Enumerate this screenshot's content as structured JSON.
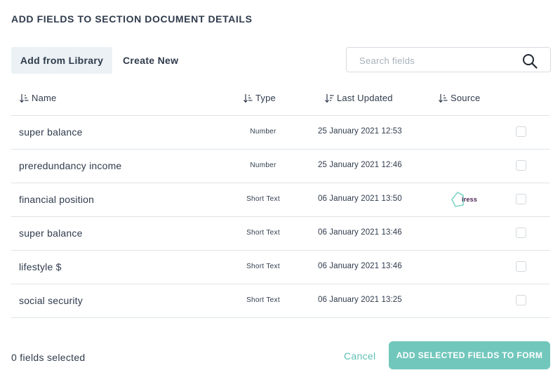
{
  "modal": {
    "title": "ADD FIELDS TO SECTION DOCUMENT DETAILS"
  },
  "tabs": [
    {
      "label": "Add from Library",
      "active": true
    },
    {
      "label": "Create New",
      "active": false
    }
  ],
  "search": {
    "placeholder": "Search fields",
    "value": "",
    "icon": "search-icon"
  },
  "table": {
    "columns": [
      {
        "label": "Name",
        "icon": "sort-icon"
      },
      {
        "label": "Type",
        "icon": "sort-icon"
      },
      {
        "label": "Last Updated",
        "icon": "sort-icon"
      },
      {
        "label": "Source",
        "icon": "sort-icon"
      }
    ],
    "rows": [
      {
        "name": "super balance",
        "type": "Number",
        "updated": "25 January 2021 12:53",
        "source": "",
        "checked": false
      },
      {
        "name": "preredundancy income",
        "type": "Number",
        "updated": "25 January 2021 12:46",
        "source": "",
        "checked": false
      },
      {
        "name": "financial position",
        "type": "Short Text",
        "updated": "06 January 2021 13:50",
        "source": "iress",
        "checked": false
      },
      {
        "name": "super balance",
        "type": "Short Text",
        "updated": "06 January 2021 13:46",
        "source": "",
        "checked": false
      },
      {
        "name": "lifestyle $",
        "type": "Short Text",
        "updated": "06 January 2021 13:46",
        "source": "",
        "checked": false
      },
      {
        "name": "social security",
        "type": "Short Text",
        "updated": "06 January 2021 13:25",
        "source": "",
        "checked": false
      }
    ]
  },
  "footer": {
    "selected_count": "0 fields selected",
    "cancel_label": "Cancel",
    "add_label": "ADD SELECTED FIELDS TO FORM"
  },
  "colors": {
    "accent": "#72c7bc",
    "text": "#2f3b4c",
    "active_tab_bg": "#ebf1f4",
    "border": "#dfe3e7",
    "brand_iress": "#4a2250"
  }
}
